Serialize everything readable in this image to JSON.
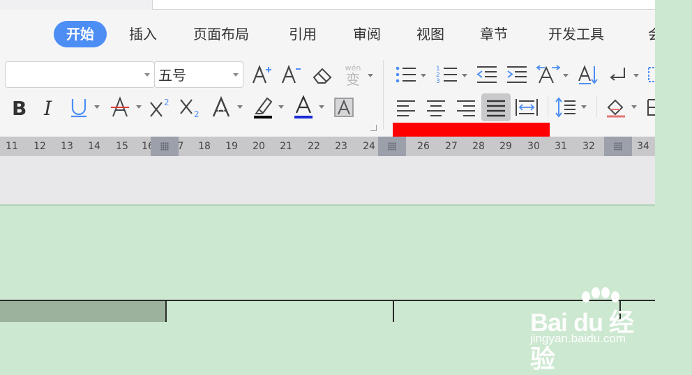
{
  "tabs": [
    "开始",
    "插入",
    "页面布局",
    "引用",
    "审阅",
    "视图",
    "章节",
    "开发工具",
    "会"
  ],
  "active_tab": "开始",
  "font_name": {
    "value": ""
  },
  "font_size": {
    "value": "五号"
  },
  "toolbar": {
    "pinyin_label": "wén",
    "pinyin_char": "变"
  },
  "ruler": {
    "ticks": [
      "11",
      "12",
      "13",
      "14",
      "15",
      "16",
      "7",
      "18",
      "19",
      "20",
      "21",
      "22",
      "23",
      "24",
      "26",
      "27",
      "28",
      "29",
      "30",
      "31",
      "32",
      "34"
    ]
  },
  "colors": {
    "accent": "#4d8ef5",
    "highlight_bar": "#ff0000",
    "font_color_underline": "#1a2bd6",
    "highlight_underline": "#000000",
    "page_background": "#cce8d0"
  },
  "watermark": {
    "brand": "Bai du 经验",
    "url": "jingyan.baidu.com"
  }
}
